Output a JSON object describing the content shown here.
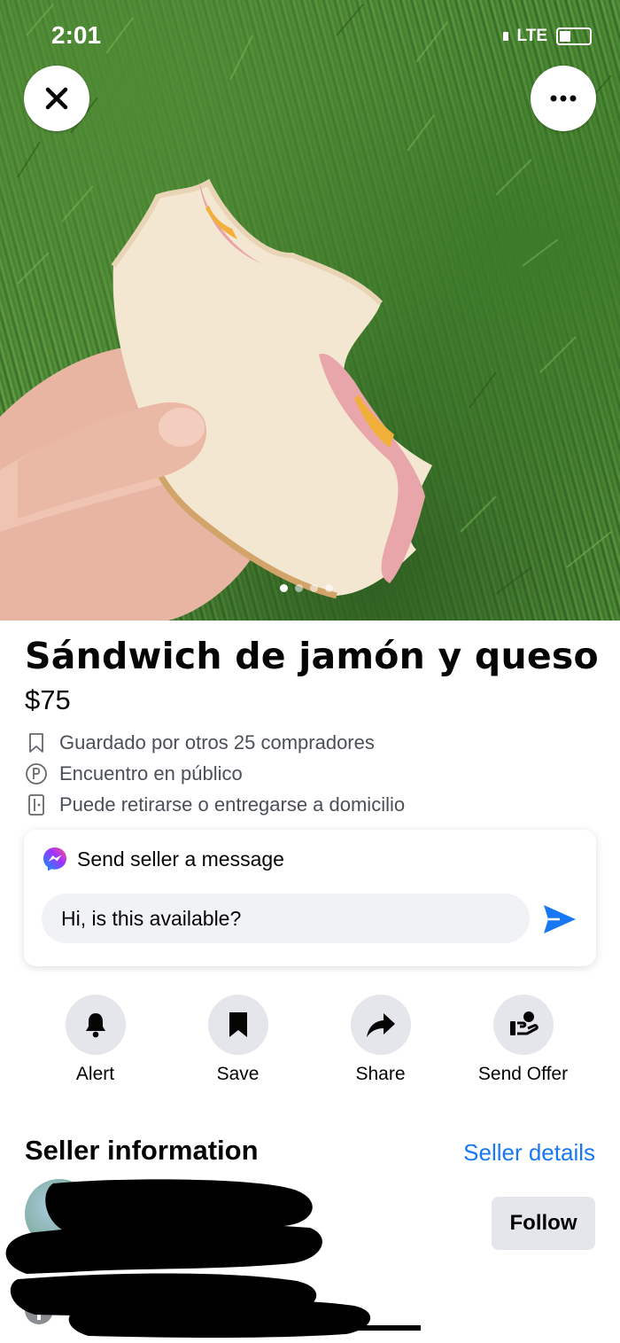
{
  "status_bar": {
    "time": "2:01",
    "network": "LTE"
  },
  "header_buttons": {
    "close_icon": "close-icon",
    "more_icon": "more-icon"
  },
  "photo": {
    "image_count": 4,
    "active_index": 0
  },
  "listing": {
    "title": "Sándwich de jamón y queso",
    "price": "$75",
    "meta": [
      {
        "icon": "bookmark-outline-icon",
        "text": "Guardado por otros 25 compradores"
      },
      {
        "icon": "parking-icon",
        "text": "Encuentro en público"
      },
      {
        "icon": "door-icon",
        "text": "Puede retirarse o entregarse a domicilio"
      }
    ]
  },
  "message": {
    "title": "Send seller a message",
    "input_value": "Hi, is this available?",
    "icon": "messenger-icon",
    "send_icon": "send-icon"
  },
  "actions": [
    {
      "label": "Alert",
      "icon": "bell-icon"
    },
    {
      "label": "Save",
      "icon": "bookmark-icon"
    },
    {
      "label": "Share",
      "icon": "share-icon"
    },
    {
      "label": "Send Offer",
      "icon": "offer-icon"
    }
  ],
  "seller": {
    "title": "Seller information",
    "details_link": "Seller details",
    "follow_label": "Follow"
  },
  "colors": {
    "link": "#1877f2",
    "messenger_gradient": [
      "#0099ff",
      "#a033ff",
      "#ff5280"
    ],
    "button_gray": "#e4e6eb"
  }
}
